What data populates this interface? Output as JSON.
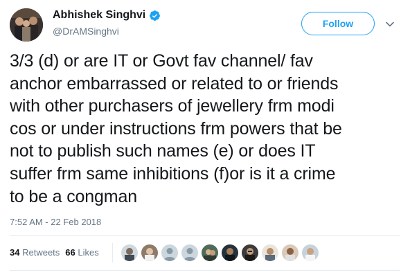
{
  "author": {
    "display_name": "Abhishek Singhvi",
    "handle": "@DrAMSinghvi",
    "verified": true,
    "avatar_icon": "profile-photo-icon"
  },
  "actions": {
    "follow_label": "Follow",
    "more_icon": "chevron-down-icon"
  },
  "tweet": {
    "lines": [
      "3/3 (d) or are IT or Govt fav channel/ fav",
      "anchor embarrassed or related to or friends",
      "with other purchasers of jewellery frm modi",
      "cos or under instructions frm powers that be",
      "not to publish such names (e) or does IT",
      "suffer frm same inhibitions (f)or is it a crime",
      "to be a congman"
    ],
    "timestamp": "7:52 AM - 22 Feb 2018"
  },
  "stats": {
    "retweets_count": "34",
    "retweets_label": "Retweets",
    "likes_count": "66",
    "likes_label": "Likes"
  },
  "colors": {
    "accent": "#1da1f2",
    "text": "#14171a",
    "secondary_text": "#657786",
    "divider": "#e6ecf0"
  }
}
